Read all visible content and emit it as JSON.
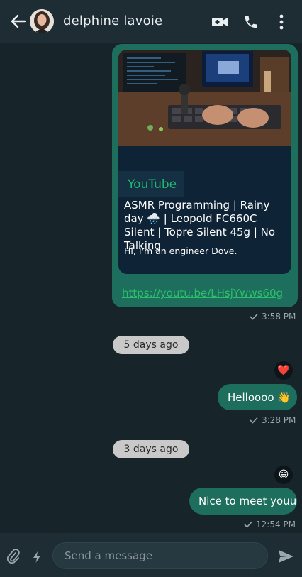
{
  "header": {
    "contact_name": "delphine lavoie",
    "icons": [
      "back-arrow-icon",
      "video-call-icon",
      "phone-icon",
      "more-vert-icon"
    ]
  },
  "link_message": {
    "source": "YouTube",
    "title": "ASMR Programming | Rainy day 🌧️ | Leopold FC660C Silent | Topre Silent 45g | No Talking",
    "description": "Hi, I'm an engineer Dove.\n\nI like to listen to repeated sounds when I work or coding. :)\n...",
    "url": "https://youtu.be/LHsjYwws60g",
    "time": "3:58 PM"
  },
  "separators": {
    "first": "5 days ago",
    "second": "3 days ago"
  },
  "messages": [
    {
      "text": "Helloooo 👋",
      "time": "3:28 PM",
      "reaction": "❤️"
    },
    {
      "text": "Nice to meet youu",
      "time": "12:54 PM",
      "reaction": "😀"
    }
  ],
  "composer": {
    "placeholder": "Send a message",
    "icons": [
      "attach-icon",
      "lightning-icon",
      "send-icon"
    ]
  },
  "colors": {
    "header_bg": "#1e2d34",
    "chat_bg": "#17252b",
    "outgoing_bubble": "#1e6e5e",
    "link_card_bg": "#0f2337",
    "link_green": "#2cbf6b",
    "date_pill": "#c9c9c9"
  }
}
